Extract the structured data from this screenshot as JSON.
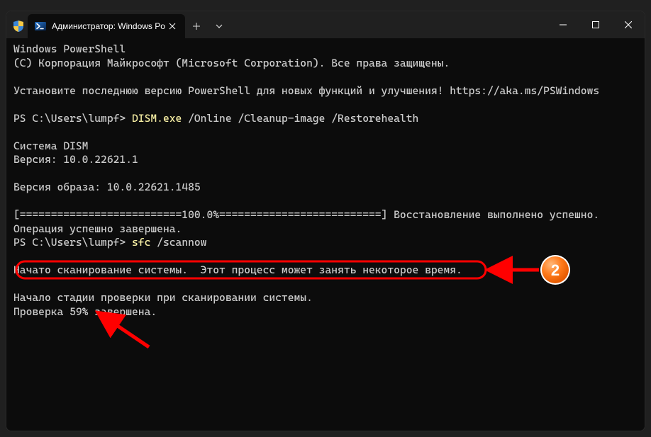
{
  "window": {
    "tab_title": "Администратор: Windows Po"
  },
  "terminal": {
    "l1": "Windows PowerShell",
    "l2": "(C) Корпорация Майкрософт (Microsoft Corporation). Все права защищены.",
    "l3": "",
    "l4": "Установите последнюю версию PowerShell для новых функций и улучшения! https://aka.ms/PSWindows",
    "l5": "",
    "prompt1_a": "PS C:\\Users\\lumpf> ",
    "prompt1_cmd": "DISM.exe",
    "prompt1_b": " /Online /Cleanup-image /Restorehealth",
    "l7": "",
    "l8": "Cистема DISM",
    "l9": "Версия: 10.0.22621.1",
    "l10": "",
    "l11": "Версия образа: 10.0.22621.1485",
    "l12": "",
    "l13": "[==========================100.0%==========================] Восстановление выполнено успешно.",
    "l14": "Операция успешно завершена.",
    "prompt2_a": "PS C:\\Users\\lumpf> ",
    "prompt2_cmd": "sfc",
    "prompt2_b": " /scannow",
    "l16": "",
    "l17": "Начато сканирование системы.  Этот процесс может занять некоторое время.",
    "l18": "",
    "l19": "Начало стадии проверки при сканировании системы.",
    "l20": "Проверка 59% завершена."
  },
  "annotation": {
    "badge_number": "2"
  }
}
